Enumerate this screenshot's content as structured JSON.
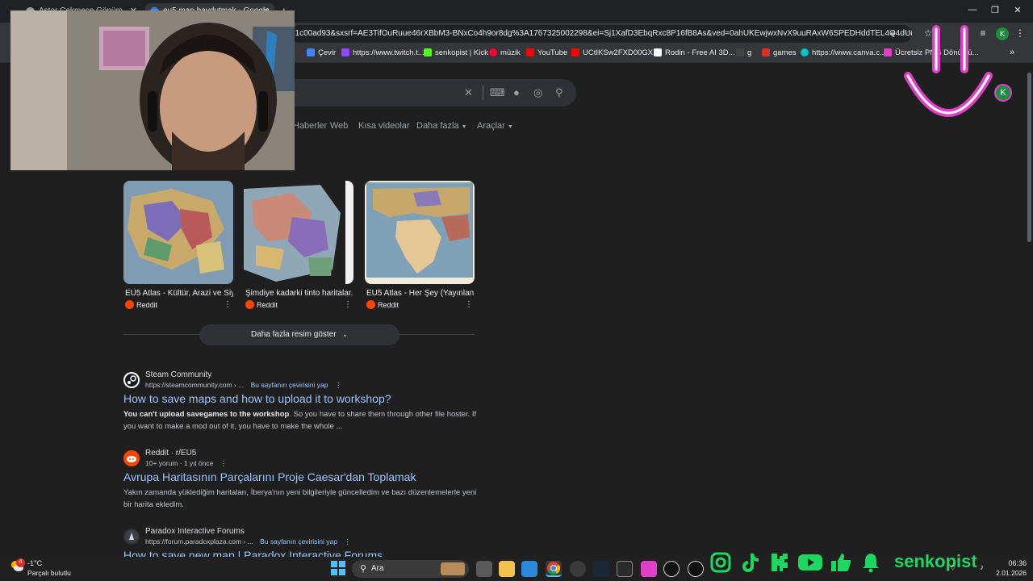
{
  "tabs": [
    {
      "label": "Astor Çekmece Gönüm..."
    },
    {
      "label": "eu5 map haydutmak - Google..."
    }
  ],
  "window": {
    "minimize": "—",
    "restore": "❐",
    "close": "✕"
  },
  "address": {
    "url": "61c00ad93&sxsrf=AE3TifOuRuue46rXBbM3-BNxCo4h9or8dg%3A1767325002298&ei=Sj1XafD3EbqRxc8P16fB8As&ved=0ahUKEwjwxNvX9uuRAxW6SPEDHddTEL4Q4dUDCBA..."
  },
  "profile": {
    "initial": "K"
  },
  "bookmarks": [
    {
      "label": "Çevir"
    },
    {
      "label": "https://www.twitch.t..."
    },
    {
      "label": "senkopist | Kick"
    },
    {
      "label": "müzik"
    },
    {
      "label": "YouTube"
    },
    {
      "label": "UCtIKSw2FXD00GX..."
    },
    {
      "label": "Rodin - Free AI 3D..."
    },
    {
      "label": "g"
    },
    {
      "label": "games"
    },
    {
      "label": "https://www.canva.c..."
    },
    {
      "label": "Ücretsiz PNG Dönüştü..."
    }
  ],
  "search_nav": {
    "items": [
      "Haberler",
      "Web",
      "Kısa videolar",
      "Daha fazla",
      "Araçlar"
    ]
  },
  "images": [
    {
      "title": "EU5 Atlas - Kültür, Arazi ve Siy...",
      "source": "Reddit"
    },
    {
      "title": "Şimdiye kadarki tinto haritalar...",
      "source": "Reddit"
    },
    {
      "title": "EU5 Atlas - Her Şey (Yayınlan...",
      "source": "Reddit"
    }
  ],
  "more_images": "Daha fazla resim göster",
  "results": [
    {
      "site": "Steam Community",
      "url": "https://steamcommunity.com › ...",
      "translate": "Bu sayfanın çevirisini yap",
      "title": "How to save maps and how to upload it to workshop?",
      "snippet_bold": "You can't upload savegames to the workshop",
      "snippet": ". So you have to share them through other file hoster. If you want to make a mod out of it, you have to make the whole ..."
    },
    {
      "site": "Reddit · r/EU5",
      "url": "10+ yorum · 1 yıl önce",
      "title": "Avrupa Haritasının Parçalarını Proje Caesar'dan Toplamak",
      "snippet": "Yakın zamanda yüklediğim haritaları, İberya'nın yeni bilgileriyle güncelledim ve bazı düzenlemelerle yeni bir harita ekledim."
    },
    {
      "site": "Paradox Interactive Forums",
      "url": "https://forum.paradoxplaza.com › ...",
      "translate": "Bu sayfanın çevirisini yap",
      "title": "How to save new map | Paradox Interactive Forums"
    }
  ],
  "taskbar": {
    "weather_temp": "-1°C",
    "weather_desc": "Parçalı bulutlu",
    "weather_badge": "4",
    "search_placeholder": "Ara",
    "time": "06:36",
    "date": "2.01.2026"
  },
  "overlay": {
    "channel": "senkopist"
  },
  "colors": {
    "accent_green": "#1ed760",
    "overlay_pink": "#e040c8",
    "link_blue": "#99c3ff"
  }
}
